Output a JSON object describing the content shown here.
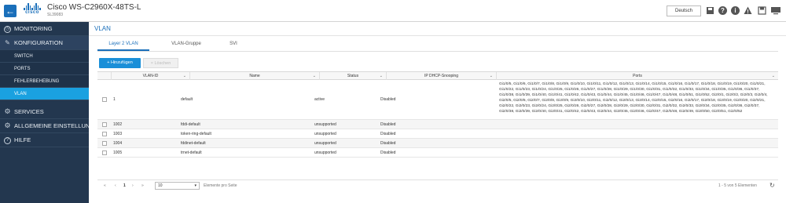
{
  "header": {
    "logo_text": "cisco",
    "model": "Cisco WS-C2960X-48TS-L",
    "hostname": "SL39083",
    "language": "Deutsch"
  },
  "sidebar": {
    "monitoring": "MONITORING",
    "konfiguration": "KONFIGURATION",
    "sub_items": [
      "SWITCH",
      "PORTS",
      "FEHLERBEHEBUNG",
      "VLAN"
    ],
    "services": "SERVICES",
    "allgemeine": "ALLGEMEINE EINSTELLUNGEN",
    "hilfe": "HILFE"
  },
  "page": {
    "title": "VLAN",
    "tabs": [
      "Layer 2 VLAN",
      "VLAN-Gruppe",
      "SVI"
    ],
    "add_button": "+ Hinzufügen",
    "delete_button": "× Löschen"
  },
  "table": {
    "headers": {
      "vlan_id": "VLAN-ID",
      "name": "Name",
      "status": "Status",
      "snooping": "IP DHCP-Snooping",
      "ports": "Ports"
    },
    "rows": [
      {
        "id": "1",
        "name": "default",
        "status": "active",
        "snooping": "Disabled",
        "ports": "Gi1/0/5, Gi1/0/6, Gi1/0/7, Gi1/0/8, Gi1/0/9, Gi1/0/10, Gi1/0/11, Gi1/0/12, Gi1/0/13, Gi1/0/14, Gi1/0/15, Gi1/0/16, Gi1/0/17, Gi1/0/18, Gi1/0/19, Gi1/0/20, Gi1/0/21, Gi1/0/22, Gi1/0/23, Gi1/0/24, Gi1/0/25, Gi1/0/26, Gi1/0/27, Gi1/0/28, Gi1/0/29, Gi1/0/30, Gi1/0/31, Gi1/0/32, Gi1/0/33, Gi1/0/34, Gi1/0/35, Gi1/0/36, Gi1/0/37, Gi1/0/38, Gi1/0/39, Gi1/0/40, Gi1/0/41, Gi1/0/42, Gi1/0/43, Gi1/0/44, Gi1/0/45, Gi1/0/46, Gi1/0/47, Gi1/0/48, Gi1/0/51, Gi1/0/52, Gi2/0/1, Gi2/0/2, Gi2/0/3, Gi2/0/4, Gi2/0/5, Gi2/0/6, Gi2/0/7, Gi2/0/8, Gi2/0/9, Gi2/0/10, Gi2/0/11, Gi2/0/12, Gi2/0/13, Gi2/0/14, Gi2/0/15, Gi2/0/16, Gi2/0/17, Gi2/0/18, Gi2/0/19, Gi2/0/20, Gi2/0/21, Gi2/0/22, Gi2/0/23, Gi2/0/24, Gi2/0/25, Gi2/0/26, Gi2/0/27, Gi2/0/28, Gi2/0/29, Gi2/0/30, Gi2/0/31, Gi2/0/32, Gi2/0/33, Gi2/0/34, Gi2/0/35, Gi2/0/36, Gi2/0/37, Gi2/0/38, Gi2/0/39, Gi2/0/40, Gi2/0/41, Gi2/0/42, Gi2/0/43, Gi2/0/44, Gi2/0/45, Gi2/0/46, Gi2/0/47, Gi2/0/48, Gi2/0/49, Gi2/0/50, Gi2/0/51, Gi2/0/52"
      },
      {
        "id": "1002",
        "name": "fddi-default",
        "status": "unsupported",
        "snooping": "Disabled",
        "ports": ""
      },
      {
        "id": "1003",
        "name": "token-ring-default",
        "status": "unsupported",
        "snooping": "Disabled",
        "ports": ""
      },
      {
        "id": "1004",
        "name": "fddinet-default",
        "status": "unsupported",
        "snooping": "Disabled",
        "ports": ""
      },
      {
        "id": "1005",
        "name": "trnet-default",
        "status": "unsupported",
        "snooping": "Disabled",
        "ports": ""
      }
    ]
  },
  "pager": {
    "first": "«",
    "prev": "‹",
    "current_page": "1",
    "next": "›",
    "last": "»",
    "page_size": "10",
    "page_size_label": "Elemente pro Seite",
    "summary": "1 - 5 von 5 Elementen",
    "refresh_icon": "refresh-icon"
  },
  "colors": {
    "accent": "#1a6fba",
    "sidebar_bg": "#23374f",
    "sidebar_active": "#1aa1e0",
    "add_button": "#1a8fd8"
  }
}
